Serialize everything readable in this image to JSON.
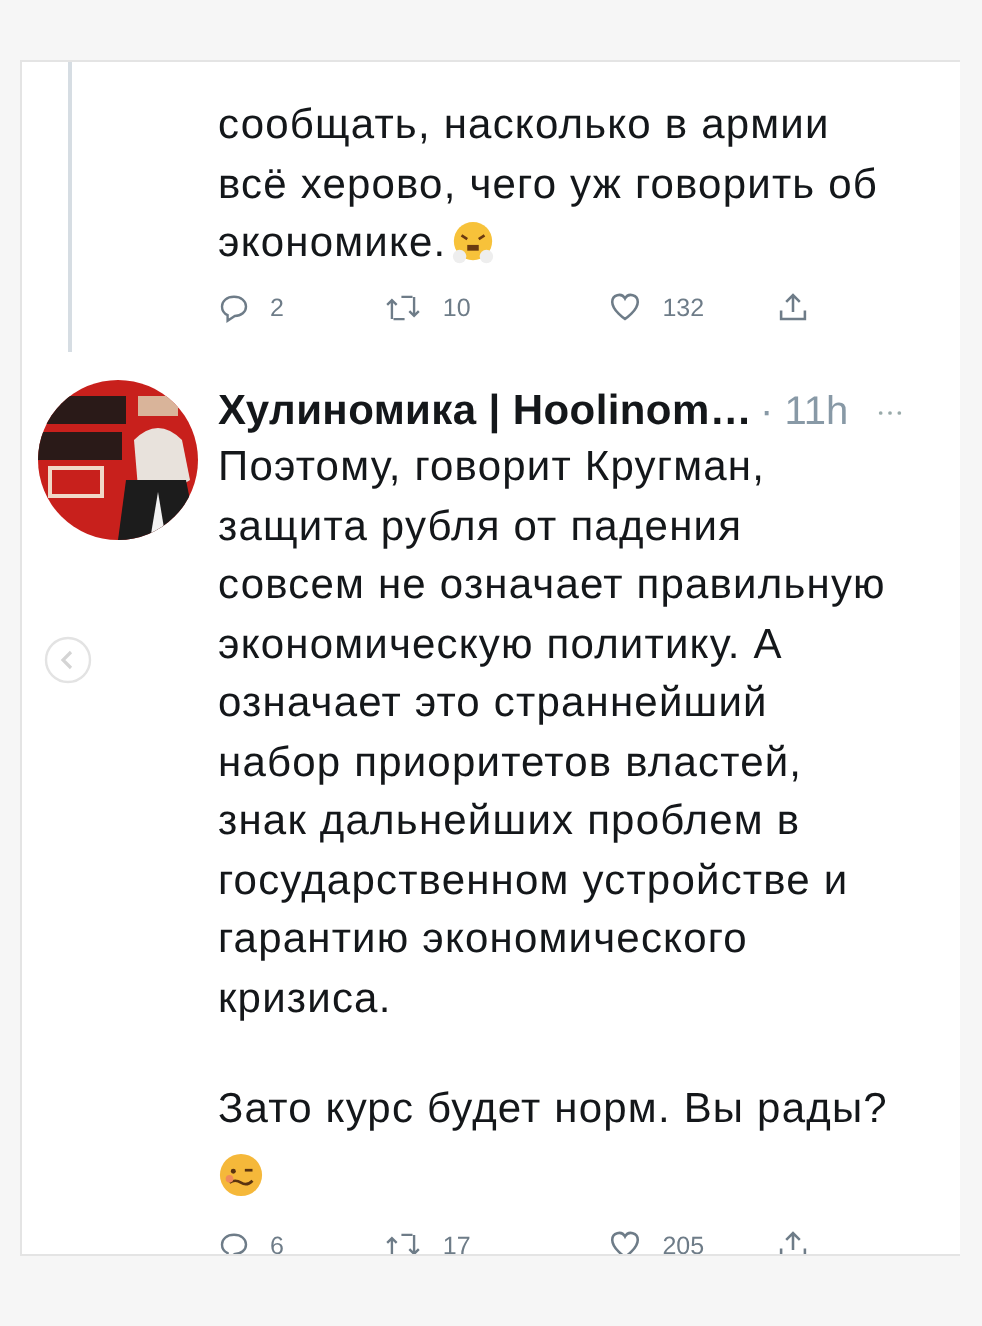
{
  "tweets": [
    {
      "thread_line": true,
      "paragraphs": [
        {
          "lines": [
            "сообщать, насколько в армии",
            "всё херово, чего уж говорить об",
            "экономике."
          ],
          "kind": "huffing"
        }
      ],
      "stats": {
        "replies": "2",
        "retweets": "10",
        "likes": "132"
      }
    },
    {
      "thread_line": false,
      "avatar": {
        "kind": "picture"
      },
      "author": {
        "name": "Хулиномика | Hoolinom…",
        "time": "· 11h"
      },
      "paragraphs": [
        {
          "lines": [
            "Поэтому, говорит Кругман,",
            "защита рубля от падения",
            "совсем не означает правильную",
            "экономическую политику. А",
            "означает это страннейший",
            "набор приоритетов властей,",
            "знак дальнейших проблем в",
            "государственном устройстве и",
            "гарантию экономического",
            "кризиса."
          ],
          "kind": "plain"
        },
        {
          "lines": [
            "Зато курс будет норм. Вы рады?"
          ],
          "kind": "woozy"
        }
      ],
      "stats": {
        "replies": "6",
        "retweets": "17",
        "likes": "205"
      }
    }
  ]
}
